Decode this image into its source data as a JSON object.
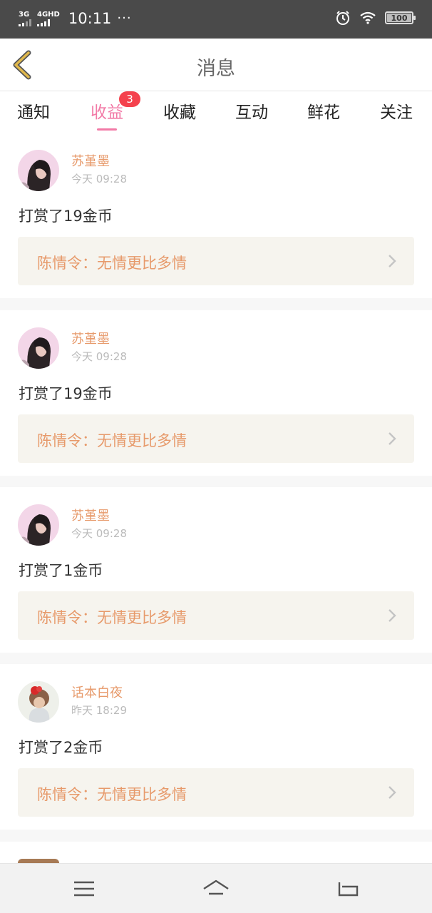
{
  "status_bar": {
    "network1": "3G",
    "network2": "4GHD",
    "time": "10:11",
    "dots": "···",
    "battery": "100"
  },
  "header": {
    "title": "消息"
  },
  "tabs": [
    {
      "label": "通知",
      "active": false
    },
    {
      "label": "收益",
      "active": true,
      "badge": "3"
    },
    {
      "label": "收藏",
      "active": false
    },
    {
      "label": "互动",
      "active": false
    },
    {
      "label": "鲜花",
      "active": false
    },
    {
      "label": "关注",
      "active": false
    }
  ],
  "messages": [
    {
      "name": "苏堇墨",
      "time": "今天 09:28",
      "text": "打赏了19金币",
      "book": "陈情令：无情更比多情"
    },
    {
      "name": "苏堇墨",
      "time": "今天 09:28",
      "text": "打赏了19金币",
      "book": "陈情令：无情更比多情"
    },
    {
      "name": "苏堇墨",
      "time": "今天 09:28",
      "text": "打赏了1金币",
      "book": "陈情令：无情更比多情"
    },
    {
      "name": "话本白夜",
      "time": "昨天 18:29",
      "text": "打赏了2金币",
      "book": "陈情令：无情更比多情"
    }
  ],
  "colors": {
    "accent_pink": "#f27aa6",
    "name_orange": "#e79a6b",
    "badge_red": "#f4414d",
    "back_arrow": "#e0b84c"
  },
  "nav": {
    "menu_icon": "menu-icon",
    "home_icon": "home-icon",
    "back_icon": "return-icon"
  }
}
